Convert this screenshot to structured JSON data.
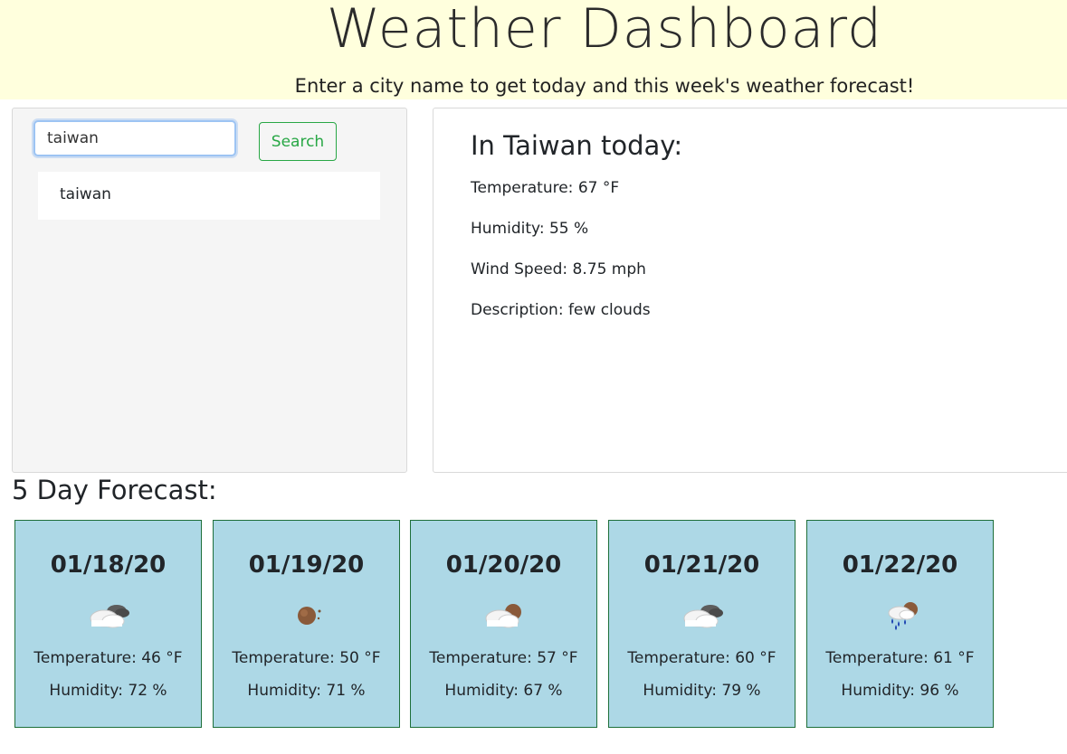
{
  "header": {
    "title": "Weather Dashboard",
    "subtitle": "Enter a city name to get today and this week's weather forecast!"
  },
  "search": {
    "value": "taiwan",
    "button_label": "Search",
    "history": [
      "taiwan"
    ]
  },
  "current": {
    "title": "In Taiwan today:",
    "temperature": "Temperature: 67 °F",
    "humidity": "Humidity: 55 %",
    "wind": "Wind Speed: 8.75 mph",
    "description": "Description: few clouds"
  },
  "forecast": {
    "heading": "5 Day Forecast:",
    "days": [
      {
        "date": "01/18/20",
        "icon": "broken-clouds-icon",
        "temperature": "Temperature: 46 °F",
        "humidity": "Humidity: 72 %"
      },
      {
        "date": "01/19/20",
        "icon": "clear-night-icon",
        "temperature": "Temperature: 50 °F",
        "humidity": "Humidity: 71 %"
      },
      {
        "date": "01/20/20",
        "icon": "few-clouds-night-icon",
        "temperature": "Temperature: 57 °F",
        "humidity": "Humidity: 67 %"
      },
      {
        "date": "01/21/20",
        "icon": "broken-clouds-icon",
        "temperature": "Temperature: 60 °F",
        "humidity": "Humidity: 79 %"
      },
      {
        "date": "01/22/20",
        "icon": "rain-night-icon",
        "temperature": "Temperature: 61 °F",
        "humidity": "Humidity: 96 %"
      }
    ]
  },
  "colors": {
    "header_bg": "#ffffdd",
    "card_bg": "#add8e6",
    "button_accent": "#28a745"
  }
}
